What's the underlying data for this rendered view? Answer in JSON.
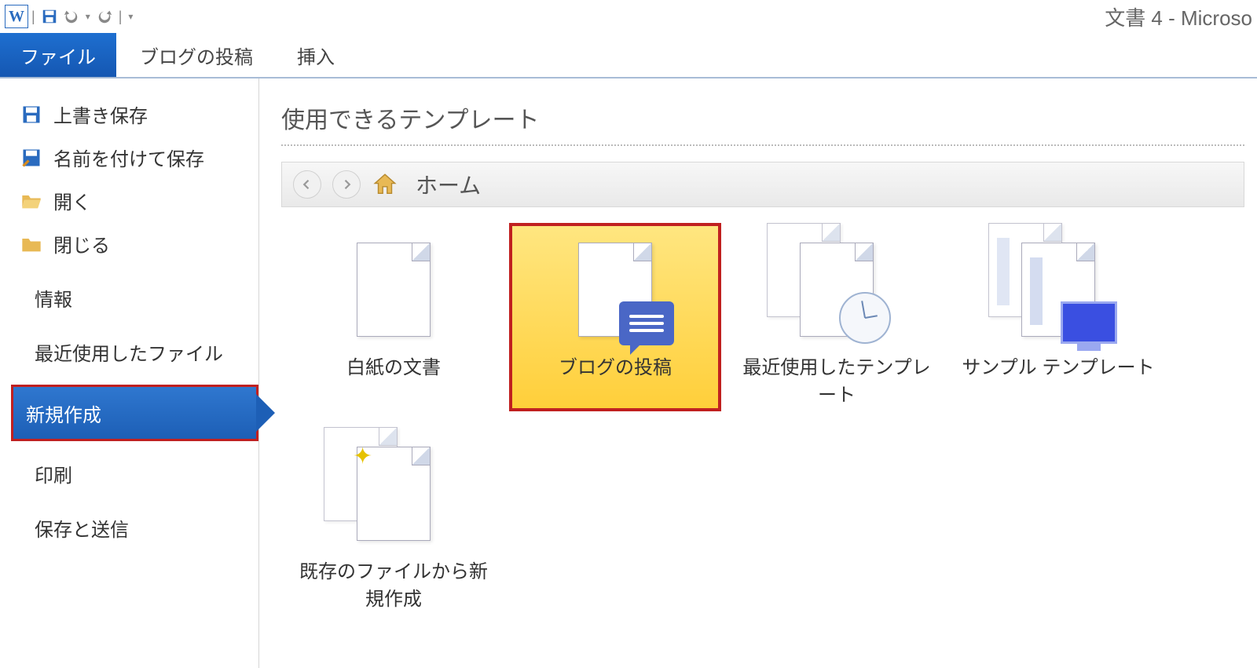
{
  "window_title": "文書 4  -  Microso",
  "ribbon_tabs": {
    "file": "ファイル",
    "blog": "ブログの投稿",
    "insert": "挿入"
  },
  "backstage": {
    "save": "上書き保存",
    "save_as": "名前を付けて保存",
    "open": "開く",
    "close": "閉じる",
    "info": "情報",
    "recent": "最近使用したファイル",
    "new": "新規作成",
    "print": "印刷",
    "save_send": "保存と送信"
  },
  "content": {
    "title": "使用できるテンプレート",
    "breadcrumb": "ホーム"
  },
  "templates": {
    "blank": "白紙の文書",
    "blog_post": "ブログの投稿",
    "recent_templates": "最近使用したテンプレート",
    "sample_templates": "サンプル テンプレート",
    "new_from_existing": "既存のファイルから新規作成"
  }
}
